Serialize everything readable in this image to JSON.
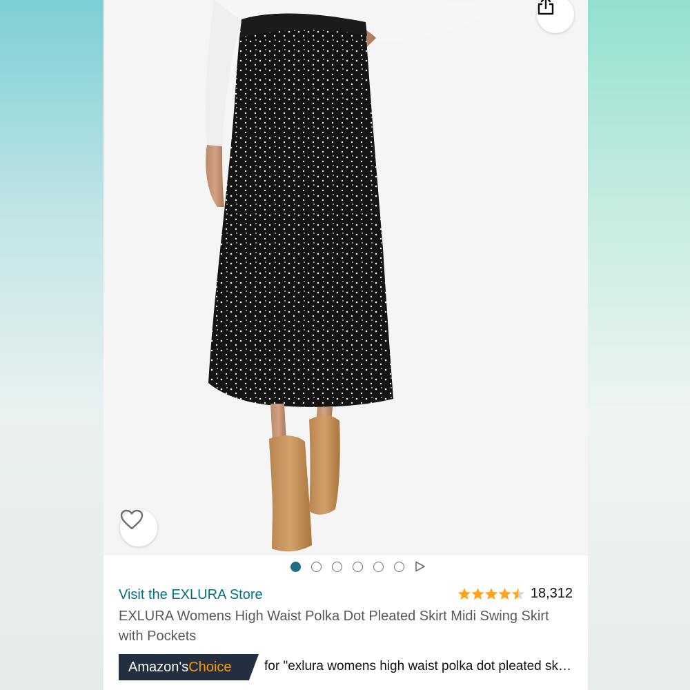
{
  "product": {
    "store_link": "Visit the EXLURA Store",
    "title": "EXLURA Womens High Waist Polka Dot Pleated Skirt Midi Swing Skirt with Pockets",
    "rating_value": 4.5,
    "rating_count": "18,312",
    "star_color": "#ffa41c"
  },
  "carousel": {
    "total_dots": 6,
    "active_index": 0
  },
  "badge": {
    "prefix": "Amazon's ",
    "highlight": "Choice",
    "query": "for \"exlura womens high waist polka dot pleated skirt\""
  },
  "icons": {
    "share": "share-icon",
    "wishlist": "heart-icon",
    "play": "play-icon"
  },
  "colors": {
    "link": "#007185",
    "badge_bg": "#232f3e",
    "badge_accent": "#ff9900",
    "active_dot": "#1d6f84"
  }
}
